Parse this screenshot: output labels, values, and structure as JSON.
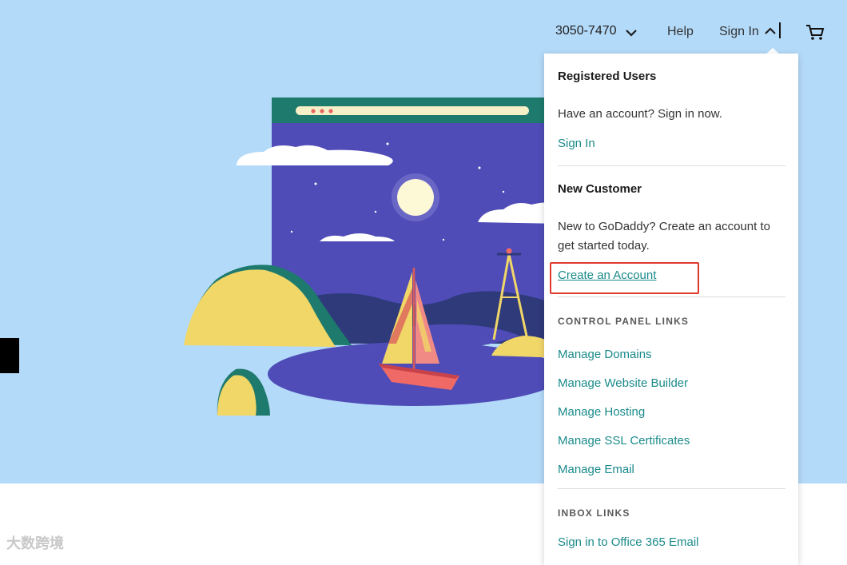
{
  "nav": {
    "phone": "3050-7470",
    "help": "Help",
    "sign_in": "Sign In",
    "icons": [
      "chevron-down-icon",
      "chevron-up-icon",
      "cart-icon"
    ]
  },
  "dropdown": {
    "registered_heading": "Registered Users",
    "registered_text": "Have an account? Sign in now.",
    "sign_in_link": "Sign In",
    "new_customer_heading": "New Customer",
    "new_customer_text": "New to GoDaddy? Create an account to get started today.",
    "create_account_link": "Create an Account",
    "control_panel_heading": "CONTROL PANEL LINKS",
    "control_panel_links": [
      "Manage Domains",
      "Manage Website Builder",
      "Manage Hosting",
      "Manage SSL Certificates",
      "Manage Email"
    ],
    "inbox_heading": "INBOX LINKS",
    "inbox_links": [
      "Sign in to Office 365 Email"
    ]
  },
  "watermark": "大数跨境",
  "colors": {
    "hero_bg": "#b4daf9",
    "link": "#1b8a8b",
    "highlight": "#e03a2e",
    "window_purple": "#4f4cb8",
    "window_top": "#1e7a6c",
    "island_yellow": "#f1d668",
    "island_teal": "#1e7a6c",
    "boat_red": "#ef6a66"
  }
}
